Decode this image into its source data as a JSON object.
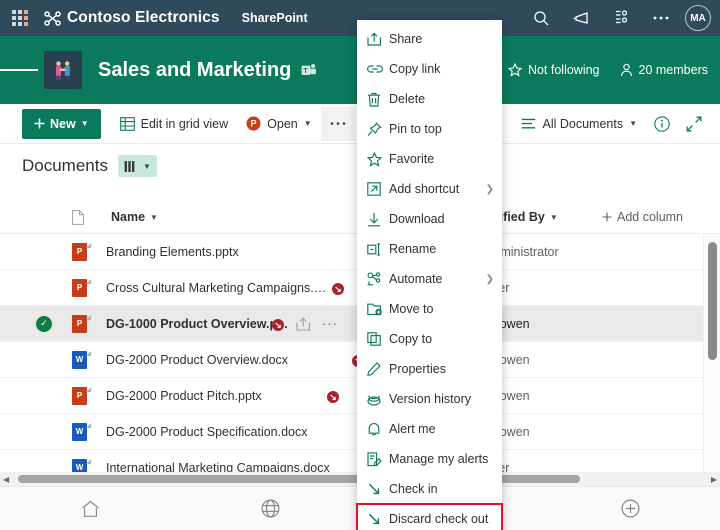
{
  "suite": {
    "waffle_icon": "app-launcher-waffle-icon",
    "brand": "Contoso Electronics",
    "brand_icon": "contoso-logo-icon",
    "app_name": "SharePoint",
    "search_icon": "search-icon",
    "megaphone_icon": "megaphone-icon",
    "apps_icon": "my-apps-icon",
    "more_icon": "more-ellipsis-icon",
    "avatar_initials": "MA"
  },
  "site": {
    "hamburger_icon": "hamburger-menu-icon",
    "logo_icon": "handshake-site-logo-icon",
    "title": "Sales and Marketing",
    "teams_icon": "microsoft-teams-icon",
    "follow_label": "Not following",
    "follow_icon": "star-outline-icon",
    "members_label": "20 members",
    "members_icon": "person-icon"
  },
  "command_bar": {
    "new_label": "New",
    "new_icon": "plus-icon",
    "edit_grid_label": "Edit in grid view",
    "edit_grid_icon": "grid-table-icon",
    "open_label": "Open",
    "open_icon": "powerpoint-icon",
    "more_label": "...",
    "more_icon": "more-ellipsis-icon",
    "view_label": "All Documents",
    "view_icon": "list-view-icon",
    "info_icon": "info-circle-icon",
    "expand_icon": "expand-diagonal-icon"
  },
  "documents": {
    "title": "Documents",
    "view_pill_icon": "column-view-icon"
  },
  "list": {
    "columns": [
      {
        "label": "Name",
        "icon": "file-type-icon",
        "sortable": true
      },
      {
        "label": "Modified By",
        "sortable": true
      },
      {
        "label": "Add column",
        "icon": "plus-icon",
        "sortable": false
      }
    ],
    "rows": [
      {
        "name": "Branding Elements.pptx",
        "type": "pptx",
        "checked_out": false,
        "modified_by": "Administrator",
        "modified_by_visible": "Administrator",
        "selected": false
      },
      {
        "name": "Cross Cultural Marketing Campaigns.pptx",
        "type": "pptx",
        "checked_out": true,
        "modified_by": "Wilber",
        "modified_by_visible": "Wilber",
        "selected": false
      },
      {
        "name": "DG-1000 Product Overview.p...",
        "type": "pptx",
        "checked_out": true,
        "modified_by": "an Bowen",
        "modified_by_visible": "an Bowen",
        "selected": true
      },
      {
        "name": "DG-2000 Product Overview.docx",
        "type": "docx",
        "checked_out": true,
        "modified_by": "an Bowen",
        "modified_by_visible": "an Bowen",
        "selected": false
      },
      {
        "name": "DG-2000 Product Pitch.pptx",
        "type": "pptx",
        "checked_out": true,
        "modified_by": "an Bowen",
        "modified_by_visible": "an Bowen",
        "selected": false
      },
      {
        "name": "DG-2000 Product Specification.docx",
        "type": "docx",
        "checked_out": false,
        "modified_by": "an Bowen",
        "modified_by_visible": "an Bowen",
        "selected": false
      },
      {
        "name": "International Marketing Campaigns.docx",
        "type": "docx",
        "checked_out": false,
        "modified_by": "Wilber",
        "modified_by_visible": "Wilber",
        "selected": false
      }
    ],
    "row_share_icon": "share-icon",
    "row_more_icon": "more-ellipsis-icon",
    "checked_out_icon": "checked-out-arrow-icon",
    "selected_check_icon": "check-circle-icon"
  },
  "context_menu": {
    "items": [
      {
        "label": "Share",
        "icon": "share-icon",
        "submenu": false
      },
      {
        "label": "Copy link",
        "icon": "link-icon",
        "submenu": false
      },
      {
        "label": "Delete",
        "icon": "trash-icon",
        "submenu": false
      },
      {
        "label": "Pin to top",
        "icon": "pin-icon",
        "submenu": false
      },
      {
        "label": "Favorite",
        "icon": "star-icon",
        "submenu": false
      },
      {
        "label": "Add shortcut",
        "icon": "shortcut-arrow-icon",
        "submenu": true
      },
      {
        "label": "Download",
        "icon": "download-arrow-icon",
        "submenu": false
      },
      {
        "label": "Rename",
        "icon": "rename-icon",
        "submenu": false
      },
      {
        "label": "Automate",
        "icon": "automate-flow-icon",
        "submenu": true
      },
      {
        "label": "Move to",
        "icon": "move-folder-icon",
        "submenu": false
      },
      {
        "label": "Copy to",
        "icon": "copy-icon",
        "submenu": false
      },
      {
        "label": "Properties",
        "icon": "pencil-icon",
        "submenu": false
      },
      {
        "label": "Version history",
        "icon": "version-history-icon",
        "submenu": false
      },
      {
        "label": "Alert me",
        "icon": "bell-icon",
        "submenu": false
      },
      {
        "label": "Manage my alerts",
        "icon": "manage-alerts-icon",
        "submenu": false
      },
      {
        "label": "Check in",
        "icon": "check-in-arrow-icon",
        "submenu": false
      },
      {
        "label": "Discard check out",
        "icon": "discard-checkout-arrow-icon",
        "submenu": false,
        "highlight": true
      }
    ]
  },
  "bottom_nav": {
    "items": [
      {
        "icon": "home-icon",
        "label": ""
      },
      {
        "icon": "globe-icon",
        "label": ""
      },
      {
        "icon": "news-icon",
        "label": ""
      },
      {
        "icon": "plus-circle-icon",
        "label": ""
      }
    ]
  },
  "scrollbars": {
    "vertical_icon": "scrollbar-down-arrow-icon",
    "horizontal_left_icon": "scrollbar-left-arrow-icon",
    "horizontal_right_icon": "scrollbar-right-arrow-icon"
  },
  "colors": {
    "suite_bar": "#2f4a5b",
    "site_theme": "#0b7a5c",
    "accent_green": "#107c41",
    "highlight_red": "#e81123",
    "checked_out_red": "#a4262c",
    "ppt_orange": "#c43e1c",
    "word_blue": "#185abd"
  }
}
